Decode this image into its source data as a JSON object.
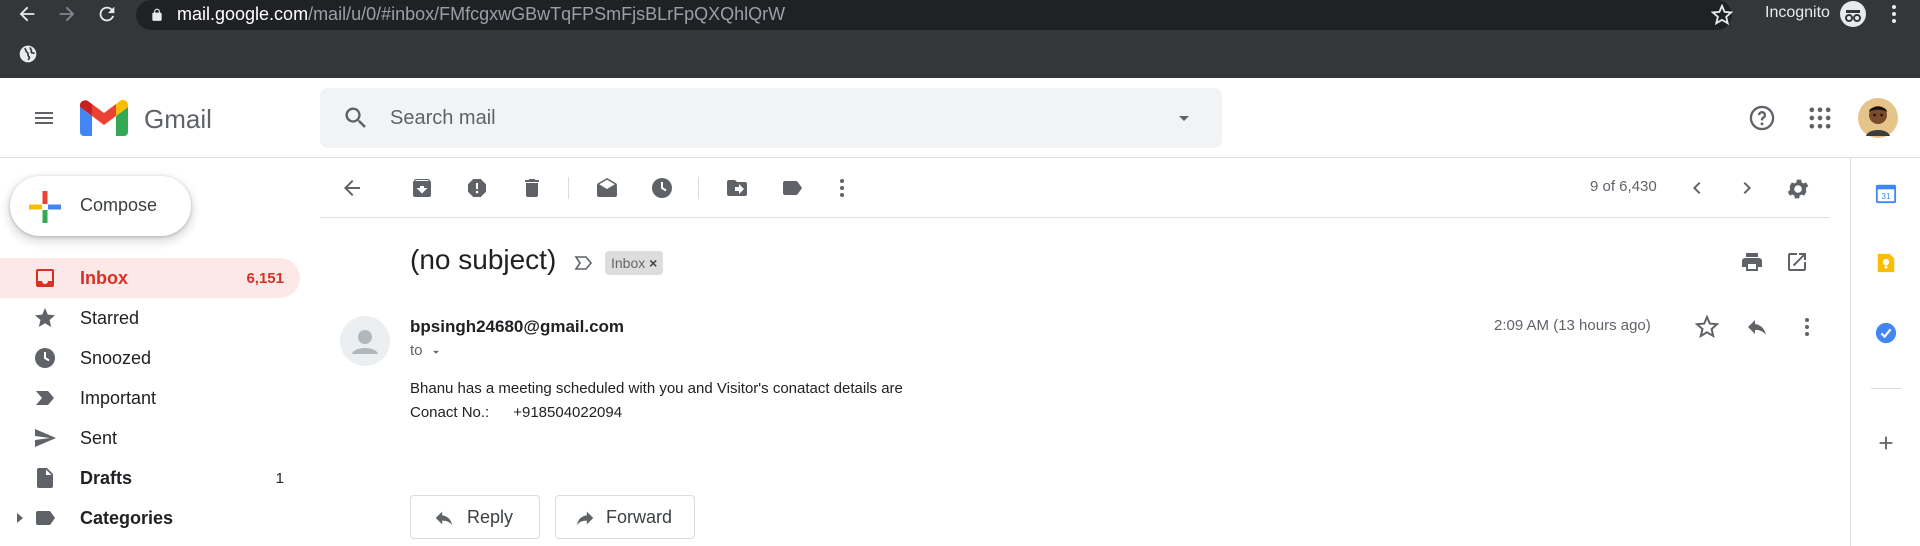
{
  "browser": {
    "url_host": "mail.google.com",
    "url_path": "/mail/u/0/#inbox/FMfcgxwGBwTqFPSmFjsBLrFpQXQhlQrW",
    "incognito_label": "Incognito"
  },
  "header": {
    "app_name": "Gmail",
    "search_placeholder": "Search mail"
  },
  "sidebar": {
    "compose_label": "Compose",
    "items": [
      {
        "label": "Inbox",
        "count": "6,151"
      },
      {
        "label": "Starred",
        "count": ""
      },
      {
        "label": "Snoozed",
        "count": ""
      },
      {
        "label": "Important",
        "count": ""
      },
      {
        "label": "Sent",
        "count": ""
      },
      {
        "label": "Drafts",
        "count": "1"
      },
      {
        "label": "Categories",
        "count": ""
      }
    ]
  },
  "toolbar": {
    "page_info": "9 of 6,430"
  },
  "email": {
    "subject": "(no subject)",
    "label": "Inbox",
    "label_close": "×",
    "sender": "bpsingh24680@gmail.com",
    "to": "to",
    "time": "2:09 AM (13 hours ago)",
    "body_line1": "Bhanu has a meeting scheduled with you and Visitor's conatact details are",
    "body_label": "Conact No.:",
    "body_number": "+918504022094",
    "reply_label": "Reply",
    "forward_label": "Forward"
  },
  "colors": {
    "accent_red": "#d93025",
    "active_bg": "#fce8e6",
    "chrome_bg": "#35363a",
    "icon_gray": "#5f6368"
  }
}
